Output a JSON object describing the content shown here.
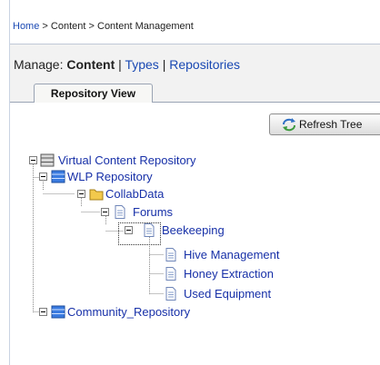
{
  "breadcrumb": {
    "home": "Home",
    "separator": ">",
    "content": "Content",
    "current": "Content Management"
  },
  "manage": {
    "prefix": "Manage:",
    "current": "Content",
    "pipe": "|",
    "types": "Types",
    "repositories": "Repositories"
  },
  "tabs": {
    "repository_view": "Repository View"
  },
  "toolbar": {
    "refresh_label": "Refresh Tree",
    "refresh_icon": "refresh-icon"
  },
  "tree": {
    "virtual_repo": "Virtual Content Repository",
    "wlp_repo": "WLP Repository",
    "collabdata": "CollabData",
    "forums": "Forums",
    "beekeeping": "Beekeeping",
    "hive_management": "Hive Management",
    "honey_extraction": "Honey Extraction",
    "used_equipment": "Used Equipment",
    "community_repo": "Community_Repository"
  },
  "colors": {
    "link": "#1a49b3",
    "tree_text": "#1730a8",
    "panel_bg": "#f2f2f2",
    "folder": "#f2c94c"
  }
}
